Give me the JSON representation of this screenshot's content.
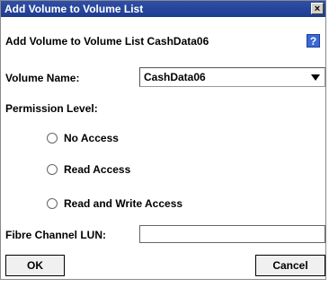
{
  "window": {
    "title": "Add Volume to Volume List",
    "close_glyph": "×"
  },
  "header": {
    "subtitle": "Add Volume to Volume List CashData06",
    "help_glyph": "?"
  },
  "volume": {
    "label": "Volume Name:",
    "selected": "CashData06"
  },
  "permission": {
    "label": "Permission Level:",
    "options": [
      {
        "label": "No Access"
      },
      {
        "label": "Read Access"
      },
      {
        "label": "Read and Write Access"
      }
    ]
  },
  "lun": {
    "label": "Fibre Channel LUN:",
    "value": ""
  },
  "buttons": {
    "ok": "OK",
    "cancel": "Cancel"
  }
}
